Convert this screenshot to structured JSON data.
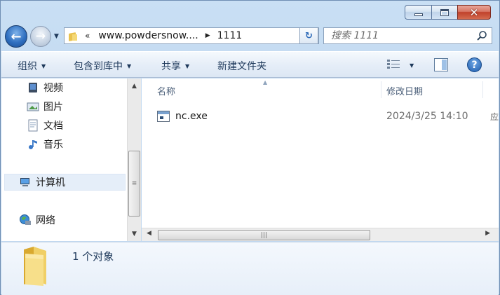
{
  "window": {
    "min_label": "",
    "max_label": "",
    "close_label": "✕"
  },
  "address": {
    "chevron": "«",
    "segment1": "www.powdersnow....",
    "arrow": "▶",
    "segment2": "1111"
  },
  "search": {
    "placeholder": "搜索 1111"
  },
  "commands": {
    "organize": "组织",
    "include_library": "包含到库中",
    "share": "共享",
    "new_folder": "新建文件夹"
  },
  "icons": {
    "back": "back-arrow-icon",
    "forward": "forward-arrow-icon",
    "search": "search-icon",
    "help": "help-icon",
    "view": "view-list-icon",
    "preview": "preview-pane-icon"
  },
  "nav": {
    "items": [
      {
        "label": "视频",
        "icon": "video-library-icon"
      },
      {
        "label": "图片",
        "icon": "pictures-library-icon"
      },
      {
        "label": "文档",
        "icon": "documents-library-icon"
      },
      {
        "label": "音乐",
        "icon": "music-library-icon"
      },
      {
        "label": "计算机",
        "icon": "computer-icon"
      },
      {
        "label": "网络",
        "icon": "network-icon"
      }
    ]
  },
  "columns": {
    "name": "名称",
    "modified": "修改日期"
  },
  "files": [
    {
      "name": "nc.exe",
      "modified": "2024/3/25 14:10",
      "more": "应"
    }
  ],
  "status": {
    "count_text": "1 个对象"
  },
  "colors": {
    "accent": "#2f6fc0",
    "frame": "#c3d9ef",
    "command_text": "#1e395b"
  }
}
